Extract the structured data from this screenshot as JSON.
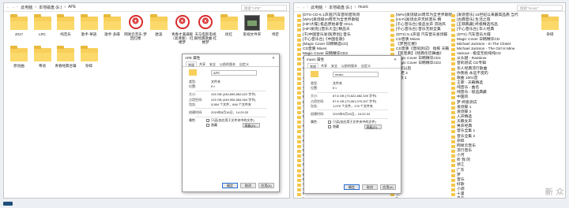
{
  "left_window": {
    "nav": "← → ↑",
    "crumbs": [
      "此电脑",
      "›",
      "本地磁盘 (E:)",
      "›",
      "APE"
    ],
    "search_placeholder": "搜索\"APE\"",
    "tiles": [
      {
        "label": "2017",
        "icon": "folder"
      },
      {
        "label": "LRC",
        "icon": "folder"
      },
      {
        "label": "纯音乐",
        "icon": "folder"
      },
      {
        "label": "歌手·華語",
        "icon": "folder"
      },
      {
        "label": "歌手·多碟",
        "icon": "folder"
      },
      {
        "label": "网易云音乐·梦回红楼",
        "icon": "netease"
      },
      {
        "label": "欧美",
        "icon": "folder"
      },
      {
        "label": "青春才满满版（高清版）-红楼梦",
        "icon": "netease"
      },
      {
        "label": "天马电影电视剧经典歌曲-红楼梦",
        "icon": "netease"
      },
      {
        "label": "民红",
        "icon": "folder"
      },
      {
        "label": "影视文件夹",
        "icon": "thumb"
      },
      {
        "label": "待定",
        "icon": "folder"
      },
      {
        "label": "原创曲",
        "icon": "folder"
      },
      {
        "label": "粤语",
        "icon": "folder"
      },
      {
        "label": "青春经典合辑",
        "icon": "folder"
      },
      {
        "label": "杂碎",
        "icon": "folder"
      }
    ],
    "dialog": {
      "title": "APE 属性",
      "close": "✕",
      "tabs": [
        "常规",
        "共享",
        "安全",
        "以前的版本",
        "自定义"
      ],
      "name": "APE",
      "rows": [
        {
          "k": "类型:",
          "v": "文件夹"
        },
        {
          "k": "位置:",
          "v": "E:\\"
        },
        {
          "k": "大小:",
          "v": "415 GB (445,896,852,622 字节)"
        },
        {
          "k": "占用空间:",
          "v": "415 GB (445,906,584,064 字节)"
        },
        {
          "k": "包含:",
          "v": "5,584 个文件，846 个文件夹"
        },
        {
          "k": "创建时间:",
          "v": "2019年8月16日，14:29:33"
        },
        {
          "k": "属性:",
          "v": "只读(仅应用于文件夹中的文件)"
        },
        {
          "k": "",
          "v": "隐藏"
        }
      ],
      "advanced": "高级(D)...",
      "buttons": [
        "确定",
        "取消",
        "应用(A)"
      ]
    }
  },
  "right_window": {
    "nav": "← → ↑",
    "crumbs": [
      "此电脑",
      "›",
      "本地磁盘 (E:)",
      "›",
      "music"
    ],
    "search_placeholder": "搜索\"music\"",
    "col1": [
      "[DTS-CD-5.1声道]汽车音响音效测",
      "[WAV]发烧级20周年为全世界歌唱",
      "[HiFi大碟] 极品原始录音 0014.",
      "[HiFi发烧] [音乐大全] 精品天",
      "[千]中国音乐发烧[原创]] 音乐",
      "[千心音乐台]《中国名歌》",
      "[Magic Cover 日韩精选CD]",
      "CD音质 Mixes",
      "Magic Cover 日韩精华CD2",
      "B 心语",
      "11H",
      "OH 日之间",
      "【",
      "4",
      "Y",
      "4.",
      "C 8 7",
      "R",
      "F",
      "Y",
      "H",
      "F",
      "-",
      "H",
      "S",
      "S",
      "E",
      "2",
      "E",
      "E",
      "S",
      "P",
      "C",
      "B",
      "D",
      "S",
      "A",
      "I",
      "I",
      "E",
      "A"
    ],
    "col2": [
      "[WAV]发烧级20周年为全世界歌唱",
      "[Hi-Fi]发烧女声无损音乐 精",
      "[千心音乐台] 极品女声 流动风",
      "[千心音乐台] 音乐无损全集",
      "(DTS) 5.1声道 汽车音乐发烧碟",
      "CD音质 Mixes",
      "《梦回红楼》",
      "CD音质《音响测试》 指挥 天籁",
      "【高音质】《经典伦巴舞曲》",
      "Magic Cover 日韩精华CD1",
      "Magic Cover 日韩精华CD2",
      "千年以后",
      "七 老 2",
      "好歌 1",
      "2",
      "Y",
      "8",
      "Y",
      "卡",
      "梦",
      "J",
      "声",
      "R",
      "C",
      "歌",
      "金",
      "苦",
      "精",
      "海",
      "男",
      "Y",
      "A",
      "传",
      "图",
      "青",
      "好",
      "少",
      "兰",
      "5",
      "C",
      "A"
    ],
    "col3": [
      "[发烧音乐] 15世纪以来最高品质 当代",
      "[古典音乐] 生活之旅",
      "[王菲典藏] 终极精选作品",
      "[千心音乐台] 华人经典",
      "(DTS) 汽车音乐大碟",
      "Magic Cover 日韩精华CD",
      "Michael Jackson - In The Closet",
      "Michael Jackson - The Girl Is Mine",
      "Various - 极度无损纯纯CD",
      "从头越 - Rainbow",
      "音响测试 CD专辑",
      "华人经典流行歌曲",
      "你我他 永远不变的",
      "歌曲 1001首",
      "王菲 - 天籁精选",
      "纯音乐 - 曲名",
      "纯音乐 - 极品典藏",
      "中国风",
      "梦 终极测试",
      "发烧碟 1",
      "发烧碟 2",
      "人声精选",
      "天籁女声",
      "男声经典",
      "音乐全集 1",
      "音乐全集 2",
      "杂碎",
      "网易云音乐",
      "流行音乐",
      "小河",
      "听 我 的",
      "浙江",
      "广东",
      "梦",
      "音乐",
      "好歌",
      "小调",
      "十里",
      "平凡"
    ],
    "tile_label": "杂碎",
    "dialog": {
      "title": "music 属性",
      "close": "✕",
      "tabs": [
        "常规",
        "共享",
        "安全",
        "以前的版本",
        "自定义"
      ],
      "name": "music",
      "rows": [
        {
          "k": "类型:",
          "v": "文件夹"
        },
        {
          "k": "位置:",
          "v": "E:\\"
        },
        {
          "k": "大小:",
          "v": "87.6 GB (73,822,882,339 字节)"
        },
        {
          "k": "占用空间:",
          "v": "87.6 GB (73,961,079,307 字节)"
        },
        {
          "k": "包含:",
          "v": "1,075 个文件，176 个文件夹"
        },
        {
          "k": "创建时间:",
          "v": "2019年9月16日，16:22:24"
        },
        {
          "k": "属性:",
          "v": "只读(仅应用于文件夹中的文件)"
        },
        {
          "k": "",
          "v": "隐藏"
        }
      ],
      "advanced": "高级(D)...",
      "buttons": [
        "确定",
        "取消",
        "应用(A)"
      ]
    }
  },
  "watermark": "新 众"
}
